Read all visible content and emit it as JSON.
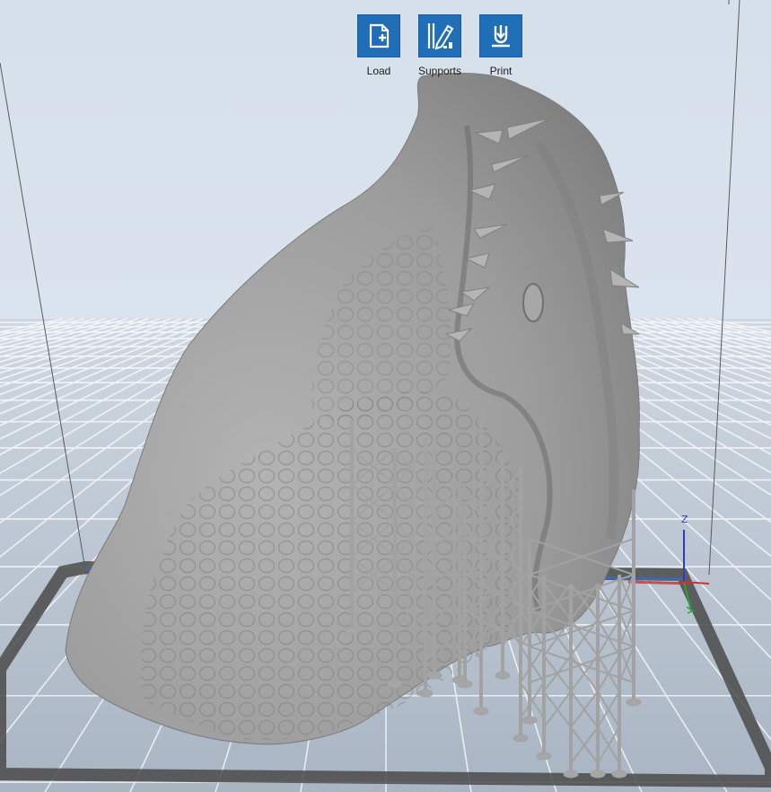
{
  "toolbar": {
    "items": [
      {
        "label": "Load",
        "icon": "load-file-icon"
      },
      {
        "label": "Supports",
        "icon": "supports-pencil-icon"
      },
      {
        "label": "Print",
        "icon": "print-download-icon"
      }
    ],
    "accent": "#1f6eb7"
  },
  "viewport": {
    "model": "dragon-head-sculpt",
    "axis_gizmo": {
      "z_label": "Z"
    },
    "colors": {
      "model": "#9a9a9a",
      "supports": "#a8a8a8",
      "grid": "#ffffff",
      "floor": "#aeb9c6",
      "border": "#4a4a4a"
    }
  }
}
